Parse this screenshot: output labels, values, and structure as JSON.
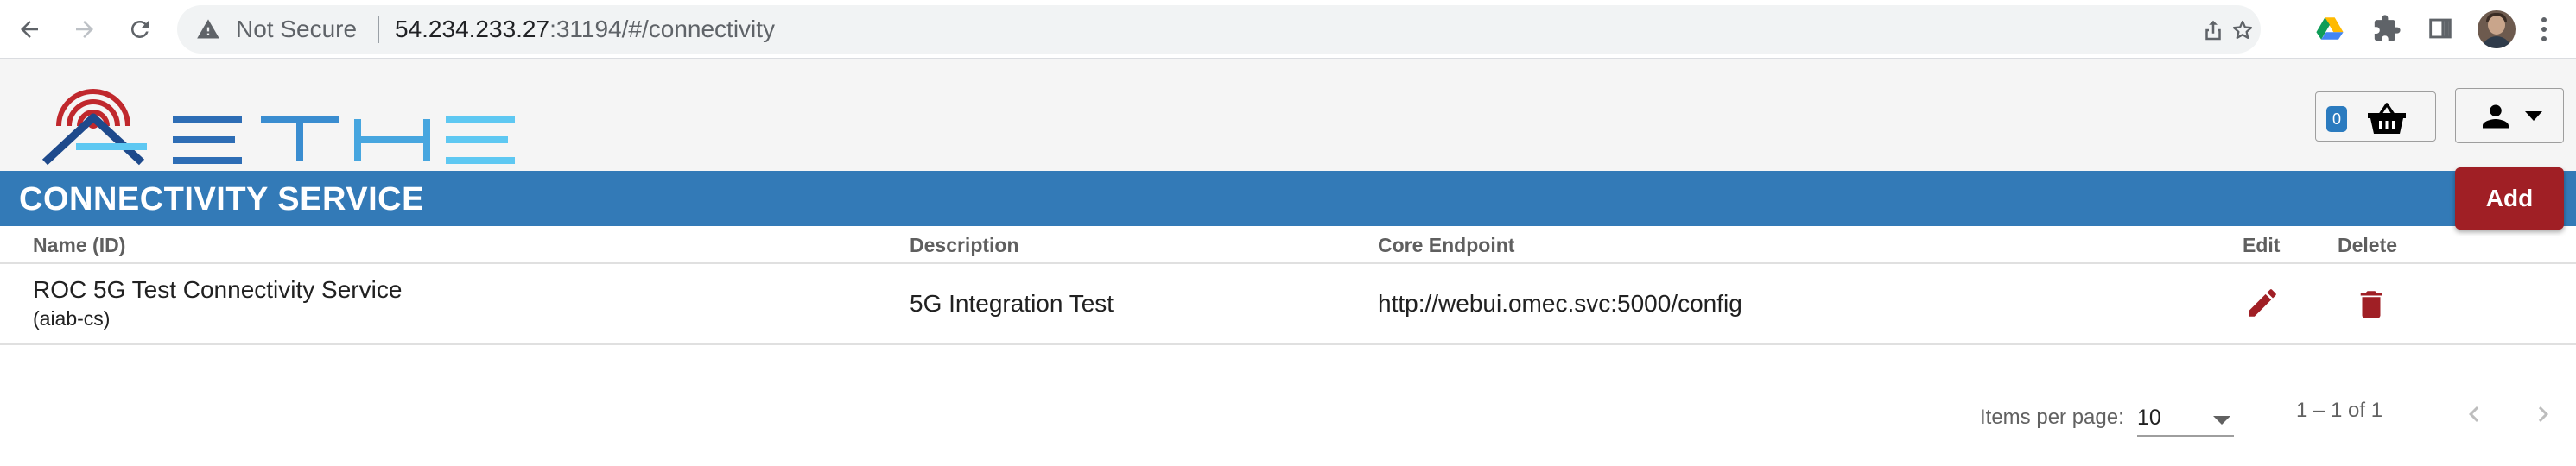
{
  "browser": {
    "security_label": "Not Secure",
    "url_host": "54.234.233.27",
    "url_rest": ":31194/#/connectivity",
    "icons": [
      "back-arrow-icon",
      "forward-arrow-icon",
      "reload-icon",
      "warning-triangle-icon",
      "share-icon",
      "bookmark-star-icon",
      "google-drive-icon",
      "extensions-puzzle-icon",
      "side-panel-icon",
      "profile-avatar",
      "more-menu-icon"
    ]
  },
  "header": {
    "logo_text": "AETHER",
    "basket_count": "0",
    "icons": [
      "basket-icon",
      "user-icon",
      "caret-down-icon"
    ]
  },
  "page": {
    "title": "CONNECTIVITY SERVICE",
    "add_label": "Add"
  },
  "table": {
    "columns": {
      "name": "Name (ID)",
      "description": "Description",
      "endpoint": "Core Endpoint",
      "edit": "Edit",
      "delete": "Delete"
    },
    "rows": [
      {
        "name": "ROC 5G Test Connectivity Service",
        "id": "(aiab-cs)",
        "description": "5G Integration Test",
        "endpoint": "http://webui.omec.svc:5000/config"
      }
    ]
  },
  "paginator": {
    "items_per_page_label": "Items per page:",
    "page_size": "10",
    "range": "1 – 1 of 1"
  },
  "colors": {
    "title_bar": "#337ab7",
    "add_button": "#a01f25",
    "edit_icon": "#a01f25",
    "delete_icon": "#a01f25",
    "badge": "#2b7bbf",
    "logo_dark": "#1e4a8c",
    "logo_light": "#5ec8f2",
    "logo_signal": "#c0282d"
  }
}
